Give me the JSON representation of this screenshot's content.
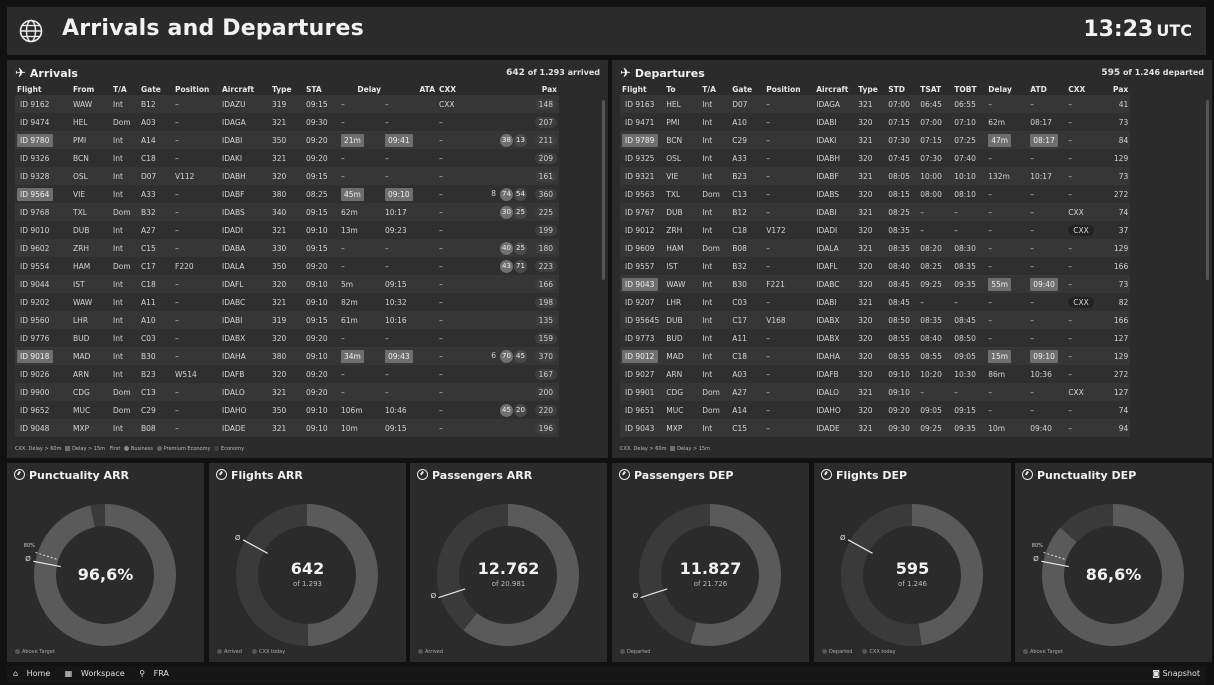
{
  "header": {
    "title": "Arrivals and Departures",
    "time": "13:23",
    "tz": "UTC",
    "icon": "globe-icon"
  },
  "arrivals": {
    "title": "Arrivals",
    "count": "642",
    "count_suffix": "of 1.293 arrived",
    "columns": [
      "Flight",
      "From",
      "T/A",
      "Gate",
      "Position",
      "Aircraft",
      "Type",
      "STA",
      "Delay",
      "ATA",
      "CXX",
      "",
      "Pax"
    ],
    "rows": [
      {
        "flight": "ID 9162",
        "from": "WAW",
        "ta": "Int",
        "gate": "B12",
        "pos": "–",
        "ac": "IDAZU",
        "type": "319",
        "sta": "09:15",
        "delay": "–",
        "ata": "–",
        "cxx": "CXX",
        "c1": "",
        "c2": "",
        "c3": "",
        "pax": "148"
      },
      {
        "flight": "ID 9474",
        "from": "HEL",
        "ta": "Dom",
        "gate": "A03",
        "pos": "–",
        "ac": "IDAGA",
        "type": "321",
        "sta": "09:30",
        "delay": "–",
        "ata": "–",
        "cxx": "–",
        "c1": "",
        "c2": "",
        "c3": "",
        "pax": "207"
      },
      {
        "flight": "ID 9780",
        "from": "PMI",
        "ta": "Int",
        "gate": "A14",
        "pos": "–",
        "ac": "IDABI",
        "type": "350",
        "sta": "09:20",
        "delay": "21m",
        "ata": "09:41",
        "cxx": "–",
        "c1": "",
        "c2": "38",
        "c3": "13",
        "pax": "211",
        "hl": true
      },
      {
        "flight": "ID 9326",
        "from": "BCN",
        "ta": "Int",
        "gate": "C18",
        "pos": "–",
        "ac": "IDAKI",
        "type": "321",
        "sta": "09:20",
        "delay": "–",
        "ata": "–",
        "cxx": "–",
        "c1": "",
        "c2": "",
        "c3": "",
        "pax": "209"
      },
      {
        "flight": "ID 9328",
        "from": "OSL",
        "ta": "Int",
        "gate": "D07",
        "pos": "V112",
        "ac": "IDABH",
        "type": "320",
        "sta": "09:15",
        "delay": "–",
        "ata": "–",
        "cxx": "–",
        "c1": "",
        "c2": "",
        "c3": "",
        "pax": "161"
      },
      {
        "flight": "ID 9564",
        "from": "VIE",
        "ta": "Int",
        "gate": "A33",
        "pos": "–",
        "ac": "IDABF",
        "type": "380",
        "sta": "08:25",
        "delay": "45m",
        "ata": "09:10",
        "cxx": "–",
        "c1": "8",
        "c2": "74",
        "c3": "54",
        "pax": "360",
        "hl": true
      },
      {
        "flight": "ID 9768",
        "from": "TXL",
        "ta": "Dom",
        "gate": "B32",
        "pos": "–",
        "ac": "IDABS",
        "type": "340",
        "sta": "09:15",
        "delay": "62m",
        "ata": "10:17",
        "cxx": "–",
        "c1": "",
        "c2": "30",
        "c3": "25",
        "pax": "225"
      },
      {
        "flight": "ID 9010",
        "from": "DUB",
        "ta": "Int",
        "gate": "A27",
        "pos": "–",
        "ac": "IDADI",
        "type": "321",
        "sta": "09:10",
        "delay": "13m",
        "ata": "09:23",
        "cxx": "–",
        "c1": "",
        "c2": "",
        "c3": "",
        "pax": "199"
      },
      {
        "flight": "ID 9602",
        "from": "ZRH",
        "ta": "Int",
        "gate": "C15",
        "pos": "–",
        "ac": "IDABA",
        "type": "330",
        "sta": "09:15",
        "delay": "–",
        "ata": "–",
        "cxx": "–",
        "c1": "",
        "c2": "40",
        "c3": "25",
        "pax": "180"
      },
      {
        "flight": "ID 9554",
        "from": "HAM",
        "ta": "Dom",
        "gate": "C17",
        "pos": "F220",
        "ac": "IDALA",
        "type": "350",
        "sta": "09:20",
        "delay": "–",
        "ata": "–",
        "cxx": "–",
        "c1": "",
        "c2": "43",
        "c3": "71",
        "pax": "223"
      },
      {
        "flight": "ID 9044",
        "from": "IST",
        "ta": "Int",
        "gate": "C18",
        "pos": "–",
        "ac": "IDAFL",
        "type": "320",
        "sta": "09:10",
        "delay": "5m",
        "ata": "09:15",
        "cxx": "–",
        "c1": "",
        "c2": "",
        "c3": "",
        "pax": "166"
      },
      {
        "flight": "ID 9202",
        "from": "WAW",
        "ta": "Int",
        "gate": "A11",
        "pos": "–",
        "ac": "IDABC",
        "type": "321",
        "sta": "09:10",
        "delay": "82m",
        "ata": "10:32",
        "cxx": "–",
        "c1": "",
        "c2": "",
        "c3": "",
        "pax": "198"
      },
      {
        "flight": "ID 9560",
        "from": "LHR",
        "ta": "Int",
        "gate": "A10",
        "pos": "–",
        "ac": "IDABI",
        "type": "319",
        "sta": "09:15",
        "delay": "61m",
        "ata": "10:16",
        "cxx": "–",
        "c1": "",
        "c2": "",
        "c3": "",
        "pax": "135"
      },
      {
        "flight": "ID 9776",
        "from": "BUD",
        "ta": "Int",
        "gate": "C03",
        "pos": "–",
        "ac": "IDABX",
        "type": "320",
        "sta": "09:20",
        "delay": "–",
        "ata": "–",
        "cxx": "–",
        "c1": "",
        "c2": "",
        "c3": "",
        "pax": "159"
      },
      {
        "flight": "ID 9018",
        "from": "MAD",
        "ta": "Int",
        "gate": "B30",
        "pos": "–",
        "ac": "IDAHA",
        "type": "380",
        "sta": "09:10",
        "delay": "34m",
        "ata": "09:43",
        "cxx": "–",
        "c1": "6",
        "c2": "70",
        "c3": "45",
        "pax": "370",
        "hl": true
      },
      {
        "flight": "ID 9026",
        "from": "ARN",
        "ta": "Int",
        "gate": "B23",
        "pos": "W514",
        "ac": "IDAFB",
        "type": "320",
        "sta": "09:20",
        "delay": "–",
        "ata": "–",
        "cxx": "–",
        "c1": "",
        "c2": "",
        "c3": "",
        "pax": "167"
      },
      {
        "flight": "ID 9900",
        "from": "CDG",
        "ta": "Dom",
        "gate": "C13",
        "pos": "–",
        "ac": "IDALO",
        "type": "321",
        "sta": "09:20",
        "delay": "–",
        "ata": "–",
        "cxx": "–",
        "c1": "",
        "c2": "",
        "c3": "",
        "pax": "200"
      },
      {
        "flight": "ID 9652",
        "from": "MUC",
        "ta": "Dom",
        "gate": "C29",
        "pos": "–",
        "ac": "IDAHO",
        "type": "350",
        "sta": "09:10",
        "delay": "106m",
        "ata": "10:46",
        "cxx": "–",
        "c1": "",
        "c2": "45",
        "c3": "20",
        "pax": "220"
      },
      {
        "flight": "ID 9048",
        "from": "MXP",
        "ta": "Int",
        "gate": "B08",
        "pos": "–",
        "ac": "IDADE",
        "type": "321",
        "sta": "09:10",
        "delay": "10m",
        "ata": "09:15",
        "cxx": "–",
        "c1": "",
        "c2": "",
        "c3": "",
        "pax": "196"
      }
    ],
    "legend": [
      "CXX. Delay > 60m",
      "Delay > 15m",
      "First",
      "Business",
      "Premium Economy",
      "Economy"
    ]
  },
  "departures": {
    "title": "Departures",
    "count": "595",
    "count_suffix": "of 1.246 departed",
    "columns": [
      "Flight",
      "To",
      "T/A",
      "Gate",
      "Position",
      "Aircraft",
      "Type",
      "STD",
      "TSAT",
      "TOBT",
      "Delay",
      "ATD",
      "CXX",
      "Pax"
    ],
    "rows": [
      {
        "flight": "ID 9163",
        "to": "HEL",
        "ta": "Int",
        "gate": "D07",
        "pos": "–",
        "ac": "IDAGA",
        "type": "321",
        "std": "07:00",
        "tsat": "06:45",
        "tobt": "06:55",
        "delay": "–",
        "atd": "–",
        "cxx": "–",
        "pax": "41"
      },
      {
        "flight": "ID 9471",
        "to": "PMI",
        "ta": "Int",
        "gate": "A10",
        "pos": "–",
        "ac": "IDABI",
        "type": "320",
        "std": "07:15",
        "tsat": "07:00",
        "tobt": "07:10",
        "delay": "62m",
        "atd": "08:17",
        "cxx": "–",
        "pax": "73"
      },
      {
        "flight": "ID 9789",
        "to": "BCN",
        "ta": "Int",
        "gate": "C29",
        "pos": "–",
        "ac": "IDAKI",
        "type": "321",
        "std": "07:30",
        "tsat": "07:15",
        "tobt": "07:25",
        "delay": "47m",
        "atd": "08:17",
        "cxx": "–",
        "pax": "84",
        "hl": true
      },
      {
        "flight": "ID 9325",
        "to": "OSL",
        "ta": "Int",
        "gate": "A33",
        "pos": "–",
        "ac": "IDABH",
        "type": "320",
        "std": "07:45",
        "tsat": "07:30",
        "tobt": "07:40",
        "delay": "–",
        "atd": "–",
        "cxx": "–",
        "pax": "129"
      },
      {
        "flight": "ID 9321",
        "to": "VIE",
        "ta": "Int",
        "gate": "B23",
        "pos": "–",
        "ac": "IDABF",
        "type": "321",
        "std": "08:05",
        "tsat": "10:00",
        "tobt": "10:10",
        "delay": "132m",
        "atd": "10:17",
        "cxx": "–",
        "pax": "73"
      },
      {
        "flight": "ID 9563",
        "to": "TXL",
        "ta": "Dom",
        "gate": "C13",
        "pos": "–",
        "ac": "IDABS",
        "type": "320",
        "std": "08:15",
        "tsat": "08:00",
        "tobt": "08:10",
        "delay": "–",
        "atd": "–",
        "cxx": "–",
        "pax": "272"
      },
      {
        "flight": "ID 9767",
        "to": "DUB",
        "ta": "Int",
        "gate": "B12",
        "pos": "–",
        "ac": "IDABI",
        "type": "321",
        "std": "08:25",
        "tsat": "–",
        "tobt": "–",
        "delay": "–",
        "atd": "–",
        "cxx": "CXX",
        "pax": "74"
      },
      {
        "flight": "ID 9012",
        "to": "ZRH",
        "ta": "Int",
        "gate": "C18",
        "pos": "V172",
        "ac": "IDADI",
        "type": "320",
        "std": "08:35",
        "tsat": "–",
        "tobt": "–",
        "delay": "–",
        "atd": "–",
        "cxx": "CXX",
        "pax": "37",
        "cxxpill": true
      },
      {
        "flight": "ID 9609",
        "to": "HAM",
        "ta": "Dom",
        "gate": "B08",
        "pos": "–",
        "ac": "IDALA",
        "type": "321",
        "std": "08:35",
        "tsat": "08:20",
        "tobt": "08:30",
        "delay": "–",
        "atd": "–",
        "cxx": "–",
        "pax": "129"
      },
      {
        "flight": "ID 9557",
        "to": "IST",
        "ta": "Int",
        "gate": "B32",
        "pos": "–",
        "ac": "IDAFL",
        "type": "320",
        "std": "08:40",
        "tsat": "08:25",
        "tobt": "08:35",
        "delay": "–",
        "atd": "–",
        "cxx": "–",
        "pax": "166"
      },
      {
        "flight": "ID 9043",
        "to": "WAW",
        "ta": "Int",
        "gate": "B30",
        "pos": "F221",
        "ac": "IDABC",
        "type": "320",
        "std": "08:45",
        "tsat": "09:25",
        "tobt": "09:35",
        "delay": "55m",
        "atd": "09:40",
        "cxx": "–",
        "pax": "73",
        "hl": true
      },
      {
        "flight": "ID 9207",
        "to": "LHR",
        "ta": "Int",
        "gate": "C03",
        "pos": "–",
        "ac": "IDABI",
        "type": "321",
        "std": "08:45",
        "tsat": "–",
        "tobt": "–",
        "delay": "–",
        "atd": "–",
        "cxx": "CXX",
        "pax": "82",
        "cxxpill": true
      },
      {
        "flight": "ID 95645",
        "to": "DUB",
        "ta": "Int",
        "gate": "C17",
        "pos": "V168",
        "ac": "IDABX",
        "type": "320",
        "std": "08:50",
        "tsat": "08:35",
        "tobt": "08:45",
        "delay": "–",
        "atd": "–",
        "cxx": "–",
        "pax": "166"
      },
      {
        "flight": "ID 9773",
        "to": "BUD",
        "ta": "Int",
        "gate": "A11",
        "pos": "–",
        "ac": "IDABX",
        "type": "320",
        "std": "08:55",
        "tsat": "08:40",
        "tobt": "08:50",
        "delay": "–",
        "atd": "–",
        "cxx": "–",
        "pax": "127"
      },
      {
        "flight": "ID 9012",
        "to": "MAD",
        "ta": "Int",
        "gate": "C18",
        "pos": "–",
        "ac": "IDAHA",
        "type": "320",
        "std": "08:55",
        "tsat": "08:55",
        "tobt": "09:05",
        "delay": "15m",
        "atd": "09:10",
        "cxx": "–",
        "pax": "129",
        "hl": true
      },
      {
        "flight": "ID 9027",
        "to": "ARN",
        "ta": "Int",
        "gate": "A03",
        "pos": "–",
        "ac": "IDAFB",
        "type": "320",
        "std": "09:10",
        "tsat": "10:20",
        "tobt": "10:30",
        "delay": "86m",
        "atd": "10:36",
        "cxx": "–",
        "pax": "272"
      },
      {
        "flight": "ID 9901",
        "to": "CDG",
        "ta": "Dom",
        "gate": "A27",
        "pos": "–",
        "ac": "IDALO",
        "type": "321",
        "std": "09:10",
        "tsat": "–",
        "tobt": "–",
        "delay": "–",
        "atd": "–",
        "cxx": "CXX",
        "pax": "127"
      },
      {
        "flight": "ID 9651",
        "to": "MUC",
        "ta": "Dom",
        "gate": "A14",
        "pos": "–",
        "ac": "IDAHO",
        "type": "320",
        "std": "09:20",
        "tsat": "09:05",
        "tobt": "09:15",
        "delay": "–",
        "atd": "–",
        "cxx": "–",
        "pax": "74"
      },
      {
        "flight": "ID 9043",
        "to": "MXP",
        "ta": "Int",
        "gate": "C15",
        "pos": "–",
        "ac": "IDADE",
        "type": "321",
        "std": "09:30",
        "tsat": "09:25",
        "tobt": "09:35",
        "delay": "10m",
        "atd": "09:40",
        "cxx": "–",
        "pax": "94"
      }
    ],
    "legend": [
      "CXX. Delay > 60m",
      "Delay > 15m"
    ]
  },
  "kpis": [
    {
      "title": "Punctuality ARR",
      "value": "96,6%",
      "sub": "",
      "fraction": 0.966,
      "target_label": "80%",
      "marker": "Ø",
      "foot": [
        "Above Target"
      ]
    },
    {
      "title": "Flights ARR",
      "value": "642",
      "sub": "of 1.293",
      "fraction": 0.497,
      "target_label": "",
      "marker": "Ø",
      "foot": [
        "Arrived",
        "CXX today"
      ]
    },
    {
      "title": "Passengers ARR",
      "value": "12.762",
      "sub": "of 20.981",
      "fraction": 0.608,
      "target_label": "",
      "marker": "Ø",
      "foot": [
        "Arrived"
      ]
    },
    {
      "title": "Passengers DEP",
      "value": "11.827",
      "sub": "of 21.726",
      "fraction": 0.544,
      "target_label": "",
      "marker": "Ø",
      "foot": [
        "Departed"
      ]
    },
    {
      "title": "Flights DEP",
      "value": "595",
      "sub": "of 1.246",
      "fraction": 0.478,
      "target_label": "",
      "marker": "Ø",
      "foot": [
        "Departed",
        "CXX today"
      ]
    },
    {
      "title": "Punctuality DEP",
      "value": "86,6%",
      "sub": "",
      "fraction": 0.866,
      "target_label": "80%",
      "marker": "Ø",
      "foot": [
        "Above Target"
      ]
    }
  ],
  "colors": {
    "background": "#111111",
    "panel": "#2b2b2b",
    "highlight": "#6e6e6e",
    "donut_track": "#3a3a3a",
    "donut_fill": "#5a5a5a"
  },
  "footer": {
    "home": "Home",
    "workspace": "Workspace",
    "location": "FRA",
    "snapshot": "Snapshot"
  }
}
